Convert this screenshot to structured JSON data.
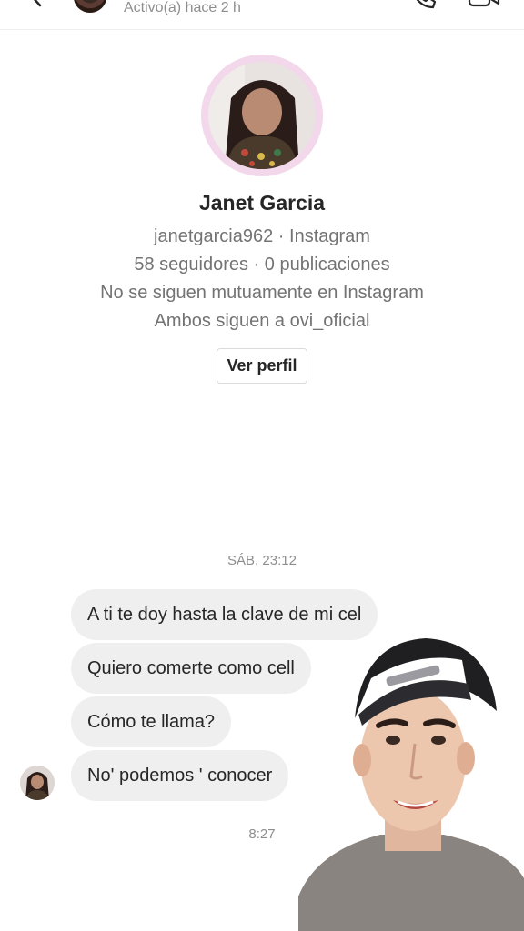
{
  "header": {
    "status": "Activo(a) hace 2 h"
  },
  "profile": {
    "name": "Janet Garcia",
    "handle_line": "janetgarcia962 · Instagram",
    "stats_line": "58 seguidores · 0 publicaciones",
    "mutual_line": "No se siguen mutuamente en Instagram",
    "common_line": "Ambos siguen a ovi_oficial",
    "view_profile_label": "Ver perfil"
  },
  "thread": {
    "date_stamp": "SÁB, 23:12",
    "messages": [
      "A ti te doy hasta la clave de mi cel",
      "Quiero comerte como cell",
      "Cómo te llama?",
      "No' podemos ' conocer"
    ],
    "time_stamp": "8:27"
  },
  "colors": {
    "bubble_bg": "#efefef",
    "avatar_ring": "#f3d7ea",
    "secondary_text": "#737373"
  },
  "icons": [
    "back-arrow-icon",
    "phone-icon",
    "video-camera-icon"
  ]
}
